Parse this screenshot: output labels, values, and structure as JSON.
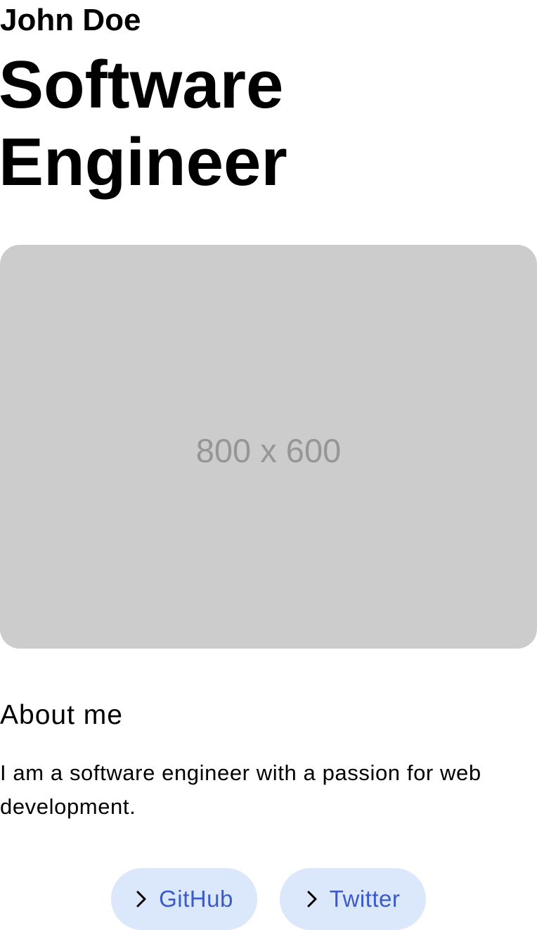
{
  "profile": {
    "name": "John Doe",
    "headline": "Software Engineer"
  },
  "hero": {
    "image_label": "800 x 600",
    "background_color": "#cccccc"
  },
  "about": {
    "heading": "About me",
    "text": "I am a software engineer with a passion for web development."
  },
  "links": [
    {
      "label": "GitHub",
      "icon": "chevron-right-icon"
    },
    {
      "label": "Twitter",
      "icon": "chevron-right-icon"
    }
  ],
  "colors": {
    "link_background": "#dbe7fa",
    "link_text": "#3a5bc8"
  }
}
